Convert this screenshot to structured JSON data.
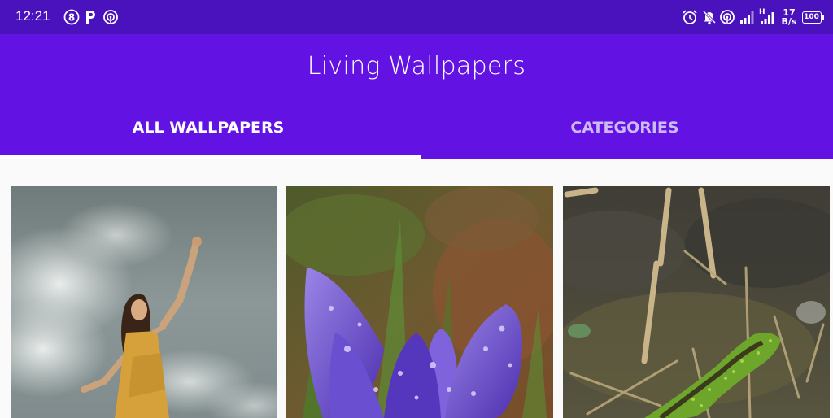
{
  "status_bar": {
    "time": "12:21",
    "network_speed_value": "17",
    "network_speed_unit": "B/s",
    "battery": "100",
    "left_icons": [
      "eight-badge-icon",
      "paytm-p-icon",
      "hotspot-icon"
    ],
    "right_icons": [
      "alarm-icon",
      "notifications-off-icon",
      "hotspot-icon",
      "signal-icon",
      "signal-h-icon",
      "battery-icon"
    ]
  },
  "app_bar": {
    "title": "Living Wallpapers"
  },
  "tabs": [
    {
      "label": "ALL WALLPAPERS",
      "selected": true
    },
    {
      "label": "CATEGORIES",
      "selected": false
    }
  ],
  "wallpapers": [
    {
      "subject": "woman in yellow dress under cloudy sky"
    },
    {
      "subject": "purple crocus flower with water drops"
    },
    {
      "subject": "green lizard in grass"
    }
  ],
  "colors": {
    "status_bar": "#4a12bd",
    "app_bar": "#6213e4",
    "tab_selected": "#ffffff",
    "tab_unselected": "#cdbaf4"
  }
}
